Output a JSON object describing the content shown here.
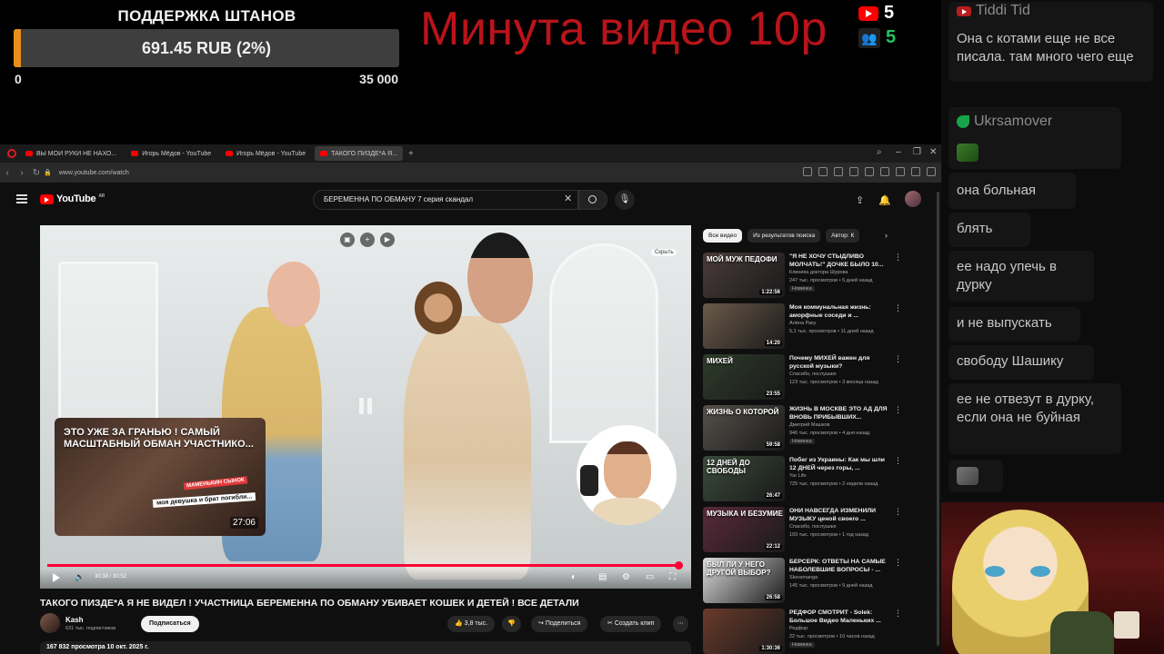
{
  "overlay": {
    "donation_title": "ПОДДЕРЖКА ШТАНОВ",
    "donation_amount": "691.45 RUB (2%)",
    "donation_progress_percent": 2,
    "goal_min": "0",
    "goal_max": "35 000",
    "price_title": "Минута видео 10р",
    "yt_count": "5",
    "viewer_count": "5",
    "colors": {
      "accent_orange": "#e8901c",
      "price_red": "#b8141a",
      "viewer_green": "#22c55e"
    }
  },
  "browser": {
    "tabs": [
      {
        "label": "ВЫ МОИ РУКИ НЕ НАХО..."
      },
      {
        "label": "Игорь Мёдов - YouTube"
      },
      {
        "label": "Игорь Мёдов - YouTube"
      },
      {
        "label": "ТАКОГО ПИЗДЕ*А Я..."
      }
    ],
    "url": "www.youtube.com/watch"
  },
  "youtube": {
    "logo_text": "YouTube",
    "region": "AR",
    "search_value": "БЕРЕМЕННА ПО ОБМАНУ 7 серия скандал",
    "player": {
      "mini_title": "ЭТО УЖЕ ЗА ГРАНЬЮ ! САМЫЙ МАСШТАБНЫЙ ОБМАН УЧАСТНИКО...",
      "mini_badge": "МАМЕНЬКИН СЫНОК",
      "mini_caption": "моя девушка и брат погибли...",
      "mini_duration": "27:06",
      "hide_label": "Скрыть",
      "time": "30:38 / 30:52",
      "progress_fraction": 0.992
    },
    "video": {
      "title": "ТАКОГО ПИЗДЕ*А Я НЕ ВИДЕЛ ! УЧАСТНИЦА БЕРЕМЕННА ПО ОБМАНУ УБИВАЕТ КОШЕК И ДЕТЕЙ ! ВСЕ ДЕТАЛИ",
      "channel": "Kash",
      "subscribers": "631 тыс. подписчиков",
      "subscribe_label": "Подписаться",
      "likes": "3,8 тыс.",
      "share_label": "Поделиться",
      "clip_label": "Создать клип",
      "views_line": "167 832 просмотра  10 окт. 2025 г."
    },
    "chips": [
      "Все видео",
      "Из результатов поиска",
      "Автор: К"
    ],
    "recommendations": [
      {
        "title": "\"Я НЕ ХОЧУ СТЫДЛИВО МОЛЧАТЬ!\" ДОЧКЕ БЫЛО 10...",
        "channel": "Клиника доктора Шурова",
        "meta": "247 тыс. просмотров • 5 дней назад",
        "badge": "Новинка",
        "duration": "1:22:56",
        "thumb_text": "МОЙ МУЖ ПЕДОФИ",
        "thumb_color": "#4a3b3b"
      },
      {
        "title": "Моя коммунальная жизнь: аморфные соседи и ...",
        "channel": "Алёна Раку",
        "meta": "5,1 тыс. просмотров • 11 дней назад",
        "badge": "",
        "duration": "14:20",
        "thumb_text": "",
        "thumb_color": "#6b5a4a"
      },
      {
        "title": "Почему МИХЕЙ важен для русской музыки?",
        "channel": "Спасибо, послушаю",
        "meta": "123 тыс. просмотров • 3 месяца назад",
        "badge": "",
        "duration": "23:55",
        "thumb_text": "МИХЕЙ",
        "thumb_color": "#2e3b2a"
      },
      {
        "title": "ЖИЗНЬ В МОСКВЕ ЭТО АД ДЛЯ ВНОВЬ ПРИБЫВШИХ...",
        "channel": "Дмитрий Машков",
        "meta": "946 тыс. просмотров • 4 дня назад",
        "badge": "Новинка",
        "duration": "59:58",
        "thumb_text": "ЖИЗНЬ О КОТОРОЙ",
        "thumb_color": "#55504a"
      },
      {
        "title": "Побег из Украины: Как мы шли 12 ДНЕЙ через горы, ...",
        "channel": "Yar Life",
        "meta": "725 тыс. просмотров • 2 недели назад",
        "badge": "",
        "duration": "26:47",
        "thumb_text": "12 ДНЕЙ ДО СВОБОДЫ",
        "thumb_color": "#3a4a3a"
      },
      {
        "title": "ОНИ НАВСЕГДА ИЗМЕНИЛИ МУЗЫКУ ценой своего ...",
        "channel": "Спасибо, послушаю",
        "meta": "193 тыс. просмотров • 1 год назад",
        "badge": "",
        "duration": "22:12",
        "thumb_text": "МУЗЫКА И БЕЗУМИЕ",
        "thumb_color": "#5a2a3a"
      },
      {
        "title": "БЕРСЕРК: ОТВЕТЫ НА САМЫЕ НАБОЛЕВШИЕ ВОПРОСЫ - ...",
        "channel": "Skeramanga",
        "meta": "145 тыс. просмотров • 9 дней назад",
        "badge": "",
        "duration": "26:58",
        "thumb_text": "БЫЛ ЛИ У НЕГО ДРУГОЙ ВЫБОР?",
        "thumb_color": "#ddd"
      },
      {
        "title": "РЕДФОР СМОТРИТ - Solek: Большое Видео Маленьких ...",
        "channel": "Редфор",
        "meta": "22 тыс. просмотров • 10 часов назад",
        "badge": "Новинка",
        "duration": "1:30:36",
        "thumb_text": "",
        "thumb_color": "#6a3a2a"
      }
    ]
  },
  "chat": {
    "messages": [
      {
        "user": "Tiddi Tid",
        "platform": "youtube",
        "text": "Она с котами еще не все писала. там много чего еще"
      },
      {
        "user": "Ukrsamover",
        "platform": "other",
        "text": ""
      },
      {
        "user": "",
        "platform": "",
        "text": "она больная"
      },
      {
        "user": "",
        "platform": "",
        "text": "блять"
      },
      {
        "user": "",
        "platform": "",
        "text": "ее надо упечь в дурку"
      },
      {
        "user": "",
        "platform": "",
        "text": "и не выпускать"
      },
      {
        "user": "",
        "platform": "",
        "text": "свободу Шашику"
      },
      {
        "user": "",
        "platform": "",
        "text": "ее не отвезут в дурку, если она не буйная"
      }
    ]
  }
}
